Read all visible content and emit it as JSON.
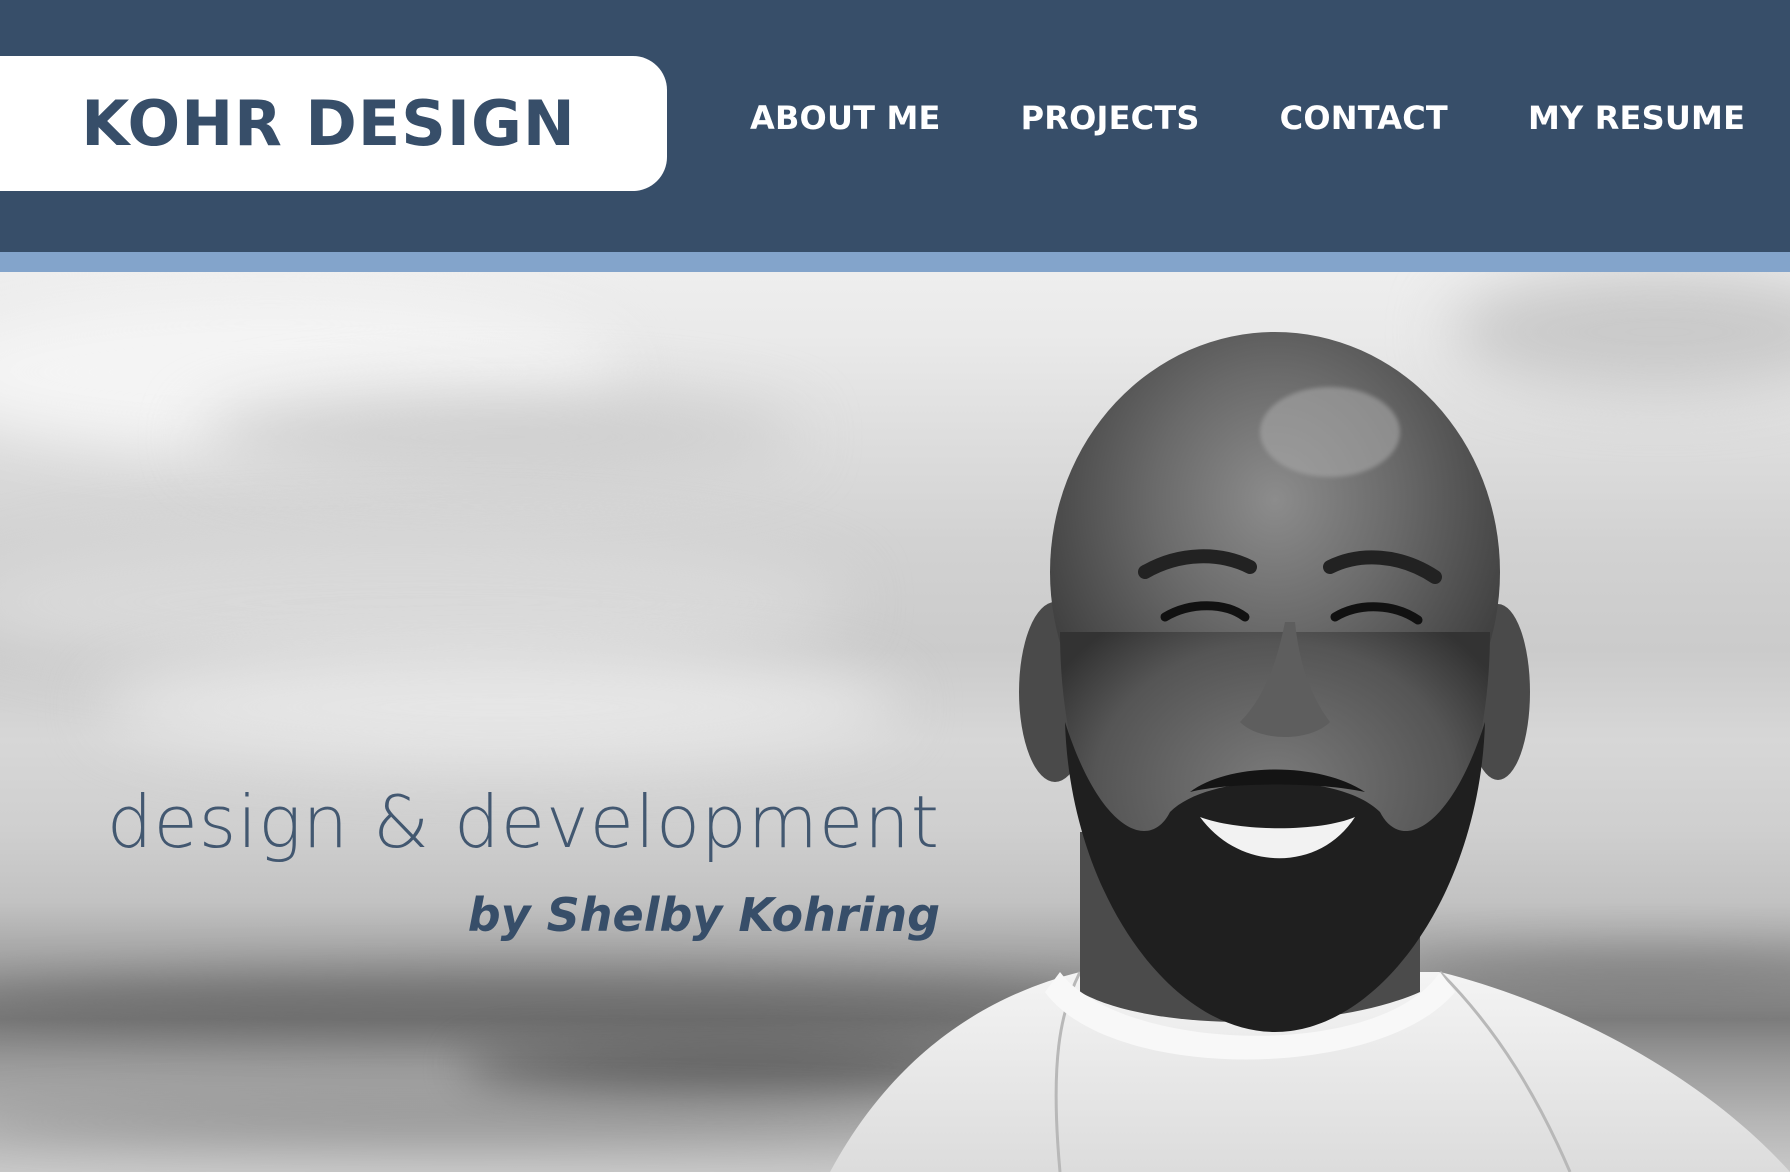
{
  "header": {
    "logo_text": "KOHR DESIGN",
    "nav": [
      {
        "label": "ABOUT ME"
      },
      {
        "label": "PROJECTS"
      },
      {
        "label": "CONTACT"
      },
      {
        "label": "MY RESUME"
      }
    ]
  },
  "hero": {
    "tagline": "design & development",
    "byline": "by Shelby Kohring"
  },
  "colors": {
    "header_bg": "#374e69",
    "accent_bar": "#83a4cb",
    "logo_bg": "#ffffff",
    "text_primary": "#374e69"
  }
}
